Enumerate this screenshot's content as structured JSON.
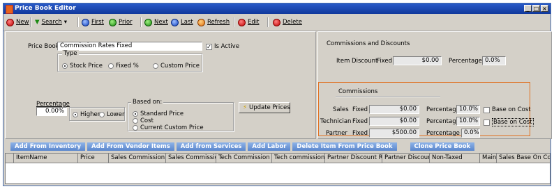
{
  "window": {
    "title": "Price Book Editor"
  },
  "toolbar": {
    "new": "New",
    "search": "Search",
    "first": "First",
    "prior": "Prior",
    "next": "Next",
    "last": "Last",
    "refresh": "Refresh",
    "edit": "Edit",
    "delete": "Delete"
  },
  "form": {
    "price_book_label": "Price Book",
    "price_book_value": "Commission Rates Fixed",
    "is_active_label": "Is Active",
    "is_active_checked": true,
    "type_label": "Type",
    "type_options": [
      "Stock Price",
      "Fixed %",
      "Custom Price"
    ],
    "type_selected": "Stock Price",
    "percentage_label": "Percentage",
    "percentage_value": "0.00%",
    "higher_label": "Higher",
    "lower_label": "Lower",
    "higher_lower_selected": "Higher",
    "based_on_label": "Based on:",
    "based_on_options": [
      "Standard Price",
      "Cost",
      "Current Custom Price"
    ],
    "based_on_selected": "Standard Price",
    "update_prices_label": "Update Prices"
  },
  "discounts": {
    "section_title": "Commissions and Discounts",
    "item_discount_label": "Item Discount",
    "fixed_label": "Fixed",
    "item_discount_fixed": "$0.00",
    "percentage_label": "Percentage",
    "item_discount_percentage": "0.0%"
  },
  "commissions": {
    "section_title": "Commissions",
    "fixed_label": "Fixed",
    "percentage_label": "Percentage",
    "rows": [
      {
        "label": "Sales",
        "fixed": "$0.00",
        "percentage": "10.0%",
        "base_on_cost": "Base on Cost"
      },
      {
        "label": "Technician",
        "fixed": "$0.00",
        "percentage": "10.0%",
        "base_on_cost": "Base on Cost"
      },
      {
        "label": "Partner",
        "fixed": "$500.00",
        "percentage": "0.0%"
      }
    ]
  },
  "tabs": [
    "Add From Inventory",
    "Add From Vendor Items",
    "Add from Services",
    "Add Labor",
    "Delete Item From Price Book",
    "Clone Price Book"
  ],
  "grid": {
    "columns": [
      "ItemName",
      "Price",
      "Sales Commission Rate",
      "Sales Commission",
      "Tech Commission Rate",
      "Tech commission",
      "Partner Discount Rate",
      "Partner Discount",
      "Non-Taxed",
      "Mainta",
      "Sales Base On Cos"
    ]
  },
  "colors": {
    "accent_orange": "#e07020",
    "tab_blue": "#5a86cc",
    "title_blue": "#10389c"
  }
}
